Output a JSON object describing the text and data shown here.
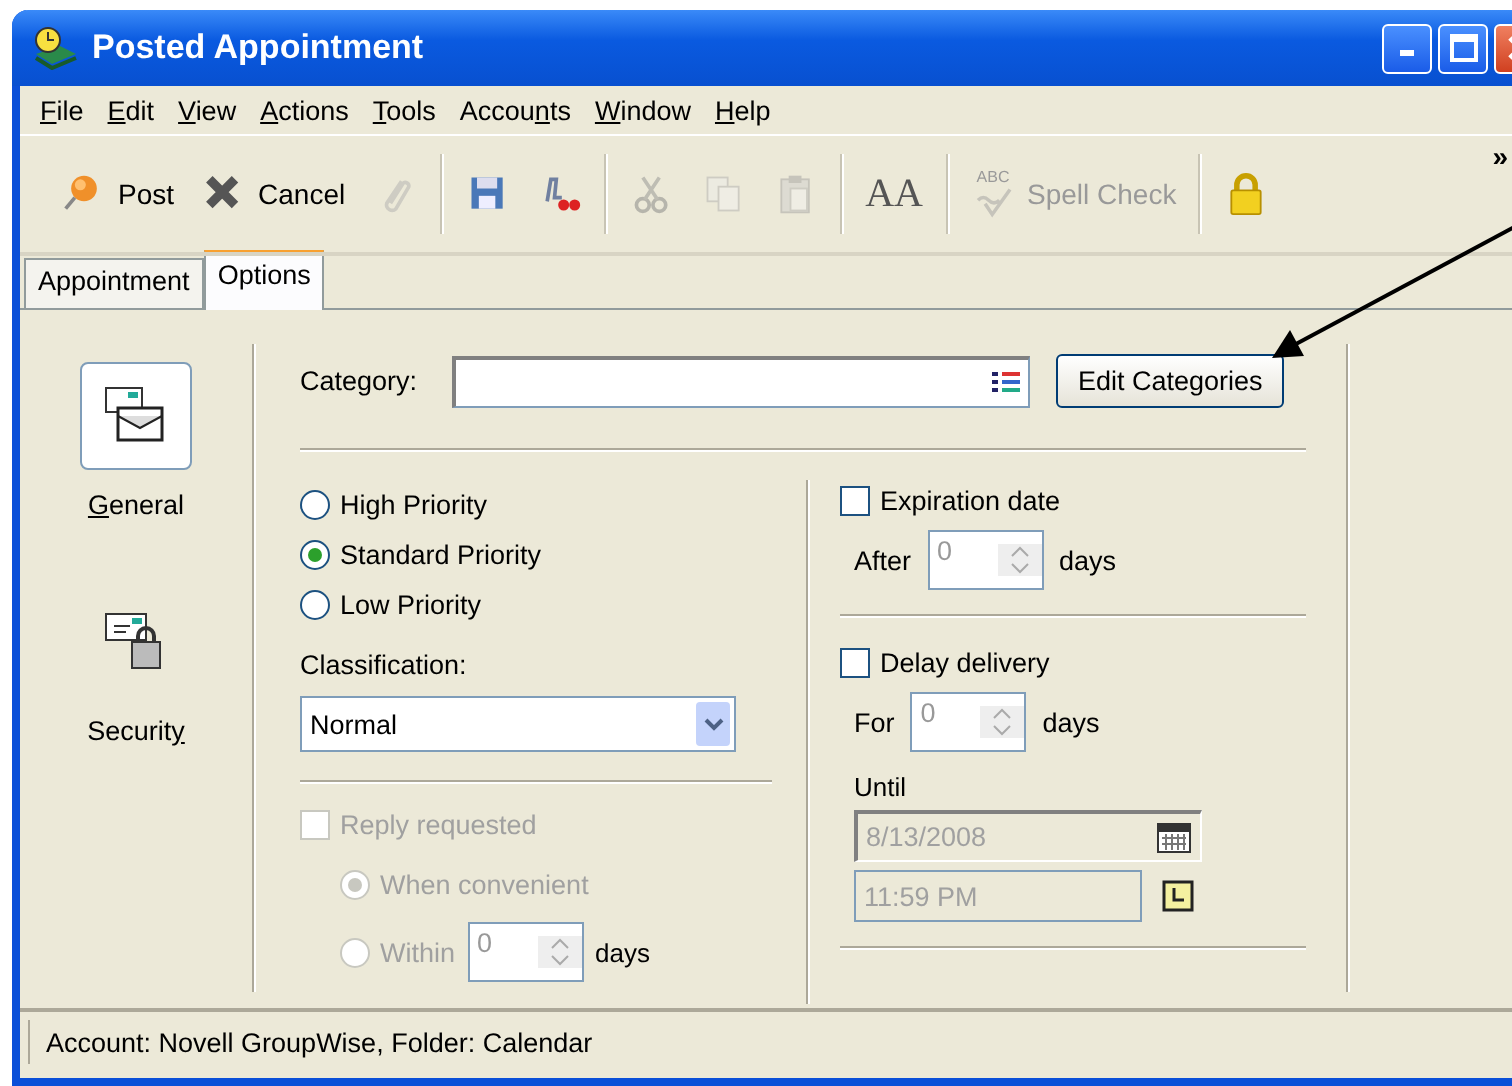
{
  "window": {
    "title": "Posted Appointment"
  },
  "menu": [
    {
      "access_key": "F",
      "after": "ile"
    },
    {
      "access_key": "E",
      "after": "dit"
    },
    {
      "access_key": "V",
      "after": "iew"
    },
    {
      "access_key": "A",
      "after": "ctions"
    },
    {
      "access_key": "T",
      "after": "ools"
    },
    {
      "before": "Accou",
      "access_key": "n",
      "after": "ts"
    },
    {
      "access_key": "W",
      "after": "indow"
    },
    {
      "access_key": "H",
      "after": "elp"
    }
  ],
  "toolbar": [
    {
      "kind": "button",
      "label": "Post",
      "disabled": false
    },
    {
      "kind": "button",
      "label": "Cancel",
      "disabled": false
    },
    {
      "kind": "button",
      "disabled": true
    },
    {
      "kind": "separator"
    },
    {
      "kind": "button",
      "disabled": false
    },
    {
      "kind": "button",
      "disabled": false
    },
    {
      "kind": "separator"
    },
    {
      "kind": "button",
      "disabled": true
    },
    {
      "kind": "button",
      "disabled": true
    },
    {
      "kind": "button",
      "disabled": true
    },
    {
      "kind": "separator"
    },
    {
      "kind": "button",
      "glyph": "AA",
      "disabled": false
    },
    {
      "kind": "separator"
    },
    {
      "kind": "button",
      "glyph": "ABC",
      "label": "Spell Check",
      "disabled": true
    },
    {
      "kind": "separator"
    },
    {
      "kind": "button",
      "disabled": false
    }
  ],
  "toolbar_overflow": "»",
  "tabs": [
    {
      "label": "Appointment",
      "selected": false
    },
    {
      "label": "Options",
      "selected": true
    }
  ],
  "sidebar": {
    "items": [
      {
        "access_key": "G",
        "after": "eneral",
        "selected": true
      },
      {
        "before": "Securit",
        "access_key": "y",
        "selected": false
      }
    ]
  },
  "category": {
    "label": "Category:",
    "button": "Edit Categories"
  },
  "priority": [
    {
      "label": "High Priority",
      "selected": false
    },
    {
      "label": "Standard Priority",
      "selected": true
    },
    {
      "label": "Low Priority",
      "selected": false
    }
  ],
  "classification": {
    "label": "Classification:",
    "value": "Normal"
  },
  "reply_requested": {
    "label": "Reply requested",
    "checked": false,
    "disabled": true,
    "options": [
      {
        "label": "When convenient",
        "selected": true
      },
      {
        "label": "Within",
        "selected": false,
        "value": "0",
        "unit": "days"
      }
    ]
  },
  "expiration": {
    "label": "Expiration date",
    "checked": false,
    "prefix": "After",
    "value": "0",
    "unit": "days"
  },
  "delay": {
    "label": "Delay delivery",
    "checked": false,
    "prefix": "For",
    "value": "0",
    "unit": "days",
    "until_label": "Until",
    "date": "8/13/2008",
    "time": "11:59 PM"
  },
  "status_bar": "Account: Novell GroupWise,  Folder: Calendar"
}
